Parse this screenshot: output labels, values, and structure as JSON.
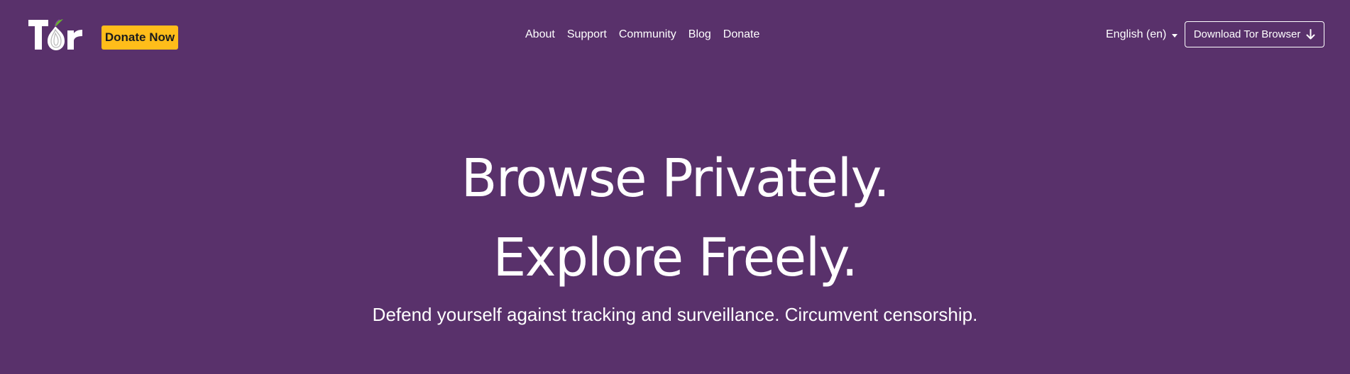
{
  "header": {
    "logo_icon": "tor-onion-logo",
    "donate_label": "Donate Now",
    "donate_color": "#ffbd1a",
    "nav": [
      {
        "label": "About"
      },
      {
        "label": "Support"
      },
      {
        "label": "Community"
      },
      {
        "label": "Blog"
      },
      {
        "label": "Donate"
      }
    ],
    "language": "English (en)",
    "download_label": "Download Tor Browser",
    "download_icon": "arrow-down-icon"
  },
  "hero": {
    "headline_1": "Browse Privately.",
    "headline_2": "Explore Freely.",
    "tagline": "Defend yourself against tracking and surveillance. Circumvent censorship."
  },
  "colors": {
    "background": "#59316b",
    "text": "#ffffff"
  }
}
